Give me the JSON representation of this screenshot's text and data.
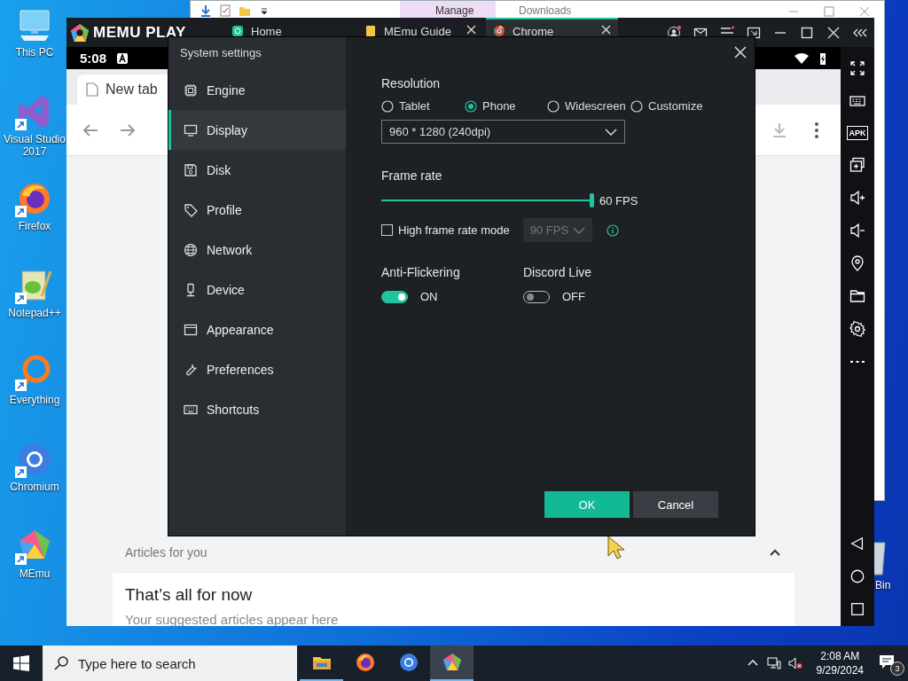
{
  "desktop_icons": [
    {
      "label": "This PC",
      "shortcut": false
    },
    {
      "label": "Visual Studio 2017",
      "shortcut": true
    },
    {
      "label": "Firefox",
      "shortcut": true
    },
    {
      "label": "Notepad++",
      "shortcut": true
    },
    {
      "label": "Everything",
      "shortcut": true
    },
    {
      "label": "Chromium",
      "shortcut": true
    },
    {
      "label": "MEmu",
      "shortcut": true
    }
  ],
  "recycle_bin": {
    "label": "Bin"
  },
  "explorer": {
    "ribbon_tab": "Manage",
    "title": "Downloads"
  },
  "emulator": {
    "logo": "MEMU PLAY",
    "tabs": [
      {
        "label": "Home",
        "selected": false,
        "closable": false
      },
      {
        "label": "MEmu Guide",
        "selected": false,
        "closable": true
      },
      {
        "label": "Chrome",
        "selected": true,
        "closable": true
      }
    ],
    "apk_label": "APK"
  },
  "android": {
    "time": "5:08",
    "browser_tab": "New tab",
    "section_title": "Articles for you",
    "card_title": "That’s all for now",
    "card_text": "Your suggested articles appear here"
  },
  "settings": {
    "title": "System settings",
    "nav": [
      {
        "label": "Engine",
        "selected": false
      },
      {
        "label": "Display",
        "selected": true
      },
      {
        "label": "Disk",
        "selected": false
      },
      {
        "label": "Profile",
        "selected": false
      },
      {
        "label": "Network",
        "selected": false
      },
      {
        "label": "Device",
        "selected": false
      },
      {
        "label": "Appearance",
        "selected": false
      },
      {
        "label": "Preferences",
        "selected": false
      },
      {
        "label": "Shortcuts",
        "selected": false
      }
    ],
    "resolution": {
      "label": "Resolution",
      "options": [
        {
          "label": "Tablet",
          "selected": false
        },
        {
          "label": "Phone",
          "selected": true
        },
        {
          "label": "Widescreen",
          "selected": false
        },
        {
          "label": "Customize",
          "selected": false
        }
      ],
      "dropdown": "960 * 1280 (240dpi)"
    },
    "frame_rate": {
      "label": "Frame rate",
      "level": 1,
      "reading": "60 FPS",
      "high_mode": {
        "label": "High frame rate mode",
        "checked": false,
        "value": "90 FPS",
        "disabled": true
      }
    },
    "toggles": [
      {
        "label": "Anti-Flickering",
        "on": true,
        "state": "ON"
      },
      {
        "label": "Discord Live",
        "on": false,
        "state": "OFF"
      }
    ],
    "buttons": [
      {
        "label": "OK",
        "kind": "primary"
      },
      {
        "label": "Cancel",
        "kind": "secondary"
      }
    ]
  },
  "taskbar": {
    "search_placeholder": "Type here to search",
    "apps": [
      {
        "running": true,
        "selected": false
      },
      {
        "running": false,
        "selected": false
      },
      {
        "running": false,
        "selected": false
      },
      {
        "running": true,
        "selected": true
      }
    ],
    "time": "2:08 AM",
    "date": "9/29/2024",
    "notification_count": "3"
  }
}
